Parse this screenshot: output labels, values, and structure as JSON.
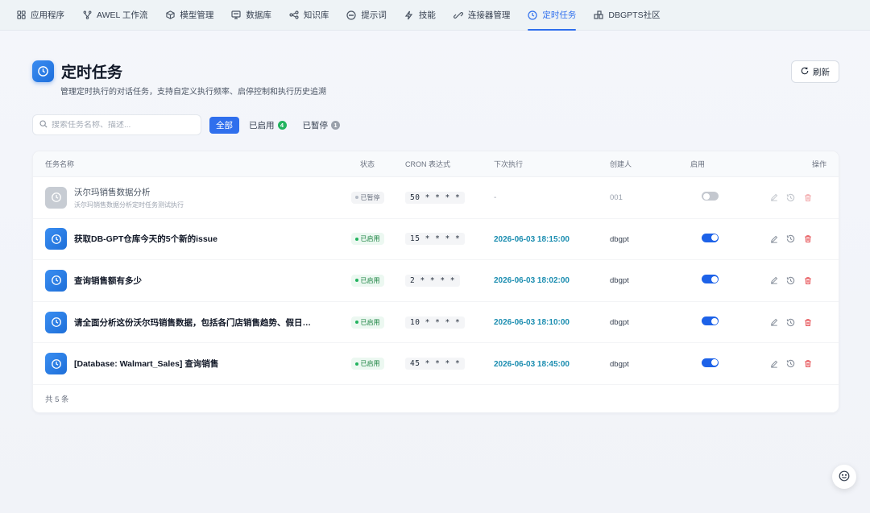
{
  "nav": {
    "items": [
      {
        "label": "应用程序",
        "icon": "grid-icon"
      },
      {
        "label": "AWEL 工作流",
        "icon": "workflow-icon"
      },
      {
        "label": "模型管理",
        "icon": "cube-icon"
      },
      {
        "label": "数据库",
        "icon": "database-icon"
      },
      {
        "label": "知识库",
        "icon": "knowledge-icon"
      },
      {
        "label": "提示词",
        "icon": "chat-icon"
      },
      {
        "label": "技能",
        "icon": "lightning-icon"
      },
      {
        "label": "连接器管理",
        "icon": "plug-icon"
      },
      {
        "label": "定时任务",
        "icon": "clock-icon",
        "active": true
      },
      {
        "label": "DBGPTS社区",
        "icon": "community-icon"
      }
    ]
  },
  "header": {
    "title": "定时任务",
    "subtitle": "管理定时执行的对话任务，支持自定义执行频率、启停控制和执行历史追溯",
    "refresh_label": "刷新"
  },
  "search": {
    "placeholder": "搜索任务名称、描述..."
  },
  "filters": [
    {
      "label": "全部",
      "active": true
    },
    {
      "label": "已启用",
      "count": "4",
      "color": "#22b35e"
    },
    {
      "label": "已暂停",
      "count": "1",
      "color": "#9aa1ab"
    }
  ],
  "table": {
    "columns": {
      "name": "任务名称",
      "status": "状态",
      "cron": "CRON 表达式",
      "next": "下次执行",
      "creator": "创建人",
      "enabled": "启用",
      "ops": "操作"
    },
    "rows": [
      {
        "name": "沃尔玛销售数据分析",
        "desc": "沃尔玛销售数据分析定时任务测试执行",
        "status": "已暂停",
        "cron": "50 * * * *",
        "next": "-",
        "creator": "001",
        "enabled": false
      },
      {
        "name": "获取DB-GPT仓库今天的5个新的issue",
        "desc": "",
        "status": "已启用",
        "cron": "15 * * * *",
        "next": "2026-06-03 18:15:00",
        "creator": "dbgpt",
        "enabled": true
      },
      {
        "name": "查询销售额有多少",
        "desc": "",
        "status": "已启用",
        "cron": "2 * * * *",
        "next": "2026-06-03 18:02:00",
        "creator": "dbgpt",
        "enabled": true
      },
      {
        "name": "请全面分析这份沃尔玛销售数据，包括各门店销售趋势、假日影响、",
        "desc": "",
        "status": "已启用",
        "cron": "10 * * * *",
        "next": "2026-06-03 18:10:00",
        "creator": "dbgpt",
        "enabled": true
      },
      {
        "name": "[Database: Walmart_Sales] 查询销售",
        "desc": "",
        "status": "已启用",
        "cron": "45 * * * *",
        "next": "2026-06-03 18:45:00",
        "creator": "dbgpt",
        "enabled": true
      }
    ],
    "total_label": "共 5 条"
  },
  "colors": {
    "accent": "#2f6fed",
    "enabled_green": "#22b35e",
    "next_time_teal": "#1b8db0",
    "delete_red": "#e5484d"
  }
}
